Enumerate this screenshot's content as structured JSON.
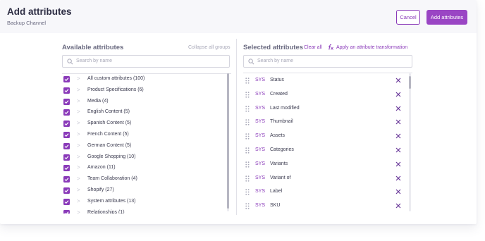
{
  "header": {
    "title": "Add attributes",
    "subtitle": "Backup Channel",
    "cancel_label": "Cancel",
    "add_label": "Add attributes"
  },
  "available": {
    "title": "Available attributes",
    "collapse_label": "Collapse all groups",
    "search_placeholder": "Search by name",
    "groups": [
      {
        "label": "All custom attributes (100)",
        "checked": true
      },
      {
        "label": "Product Specifications (6)",
        "checked": true
      },
      {
        "label": "Media (4)",
        "checked": true
      },
      {
        "label": "English Content (5)",
        "checked": true
      },
      {
        "label": "Spanish Content (5)",
        "checked": true
      },
      {
        "label": "French Content (5)",
        "checked": true
      },
      {
        "label": "German Content (5)",
        "checked": true
      },
      {
        "label": "Google Shopping (10)",
        "checked": true
      },
      {
        "label": "Amazon (11)",
        "checked": true
      },
      {
        "label": "Team Collaboration (4)",
        "checked": true
      },
      {
        "label": "Shopify (27)",
        "checked": true
      },
      {
        "label": "System attributes (13)",
        "checked": true
      },
      {
        "label": "Relationships (1)",
        "checked": true
      }
    ]
  },
  "selected": {
    "title": "Selected attributes",
    "clear_label": "Clear all",
    "transform_label": "Apply an attribute transformation",
    "search_placeholder": "Search by name",
    "items": [
      {
        "tag": "SYS",
        "label": "Status"
      },
      {
        "tag": "SYS",
        "label": "Created"
      },
      {
        "tag": "SYS",
        "label": "Last modified"
      },
      {
        "tag": "SYS",
        "label": "Thumbnail"
      },
      {
        "tag": "SYS",
        "label": "Assets"
      },
      {
        "tag": "SYS",
        "label": "Categories"
      },
      {
        "tag": "SYS",
        "label": "Variants"
      },
      {
        "tag": "SYS",
        "label": "Variant of"
      },
      {
        "tag": "SYS",
        "label": "Label"
      },
      {
        "tag": "SYS",
        "label": "SKU"
      }
    ]
  },
  "colors": {
    "accent": "#8a3ab9",
    "primary_button": "#9a45c4",
    "header_bg": "#f7f7fa"
  }
}
